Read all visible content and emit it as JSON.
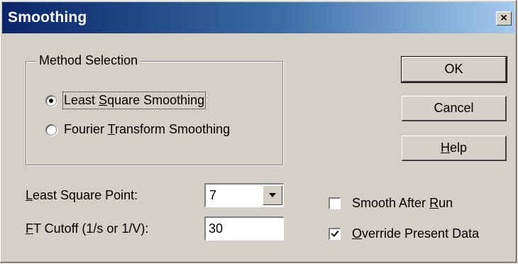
{
  "window": {
    "title": "Smoothing",
    "close_glyph": "✕"
  },
  "method_group": {
    "legend": "Method Selection",
    "options": [
      {
        "pre": "Least ",
        "mnemonic": "S",
        "post": "quare Smoothing",
        "checked": true
      },
      {
        "pre": "Fourier ",
        "mnemonic": "T",
        "post": "ransform Smoothing",
        "checked": false
      }
    ]
  },
  "buttons": {
    "ok": "OK",
    "cancel": "Cancel",
    "help_mnemonic": "H",
    "help_rest": "elp"
  },
  "least_square_point": {
    "mnemonic": "L",
    "rest": "east Square Point:",
    "value": "7"
  },
  "ft_cutoff": {
    "mnemonic": "F",
    "rest": "T Cutoff (1/s or 1/V):",
    "value": "30"
  },
  "checkboxes": [
    {
      "pre": "Smooth After ",
      "mnemonic": "R",
      "post": "un",
      "checked": false
    },
    {
      "pre": "",
      "mnemonic": "O",
      "post": "verride Present Data",
      "checked": true
    }
  ]
}
